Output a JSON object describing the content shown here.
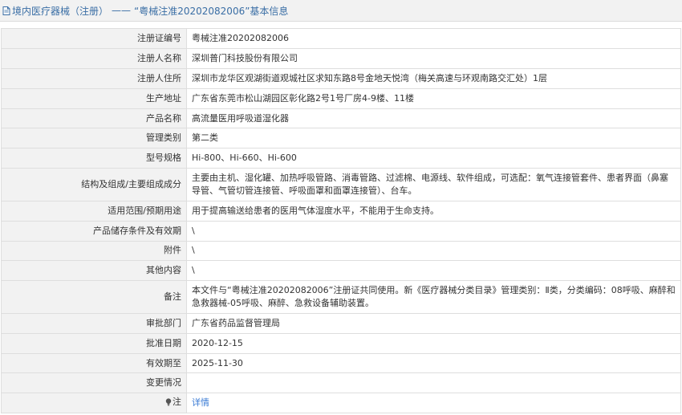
{
  "header": {
    "category": "境内医疗器械（注册）",
    "separator": "——",
    "title": "“粤械注准20202082006”基本信息"
  },
  "rows": [
    {
      "label": "注册证编号",
      "value": "粤械注准20202082006"
    },
    {
      "label": "注册人名称",
      "value": "深圳普门科技股份有限公司"
    },
    {
      "label": "注册人住所",
      "value": "深圳市龙华区观湖街道观城社区求知东路8号金地天悦湾（梅关高速与环观南路交汇处）1层"
    },
    {
      "label": "生产地址",
      "value": "广东省东莞市松山湖园区彰化路2号1号厂房4-9楼、11楼"
    },
    {
      "label": "产品名称",
      "value": "高流量医用呼吸道湿化器"
    },
    {
      "label": "管理类别",
      "value": "第二类"
    },
    {
      "label": "型号规格",
      "value": "Hi-800、Hi-660、Hi-600"
    },
    {
      "label": "结构及组成/主要组成成分",
      "value": "主要由主机、湿化罐、加热呼吸管路、消毒管路、过滤棉、电源线、软件组成，可选配：氧气连接管套件、患者界面（鼻塞导管、气管切管连接管、呼吸面罩和面罩连接管）、台车。"
    },
    {
      "label": "适用范围/预期用途",
      "value": "用于提高输送给患者的医用气体湿度水平，不能用于生命支持。"
    },
    {
      "label": "产品储存条件及有效期",
      "value": "\\"
    },
    {
      "label": "附件",
      "value": "\\"
    },
    {
      "label": "其他内容",
      "value": "\\"
    },
    {
      "label": "备注",
      "value": "本文件与“粤械注准20202082006”注册证共同使用。新《医疗器械分类目录》管理类别：Ⅱ类，分类编码：08呼吸、麻醉和急救器械-05呼吸、麻醉、急救设备辅助装置。"
    },
    {
      "label": "审批部门",
      "value": "广东省药品监督管理局"
    },
    {
      "label": "批准日期",
      "value": "2020-12-15"
    },
    {
      "label": "有效期至",
      "value": "2025-11-30"
    },
    {
      "label": "变更情况",
      "value": ""
    }
  ],
  "note": {
    "label": "注",
    "icon": "bulb-icon",
    "link_text": "详情",
    "link_color": "#3a7bd5"
  }
}
